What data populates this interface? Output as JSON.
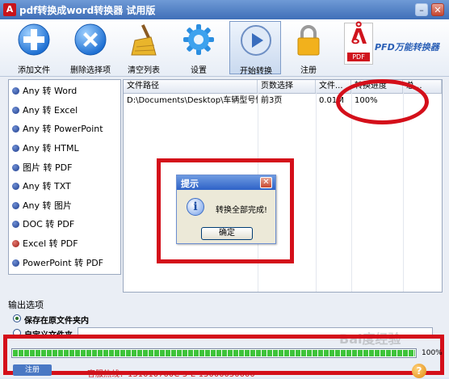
{
  "window": {
    "title": "pdf转换成word转换器 试用版",
    "min_label": "–",
    "close_label": "✕",
    "app_icon_glyph": "A"
  },
  "toolbar": {
    "add_file": "添加文件",
    "remove_selected": "删除选择项",
    "clear_list": "清空列表",
    "settings": "设置",
    "start_convert": "开始转换",
    "register": "注册",
    "brand_text": "PFD万能转换器",
    "brand_pdf_tag": "PDF",
    "brand_acrobat_glyph": "ᕔ"
  },
  "formats": [
    {
      "label": "Any 转 Word"
    },
    {
      "label": "Any 转 Excel"
    },
    {
      "label": "Any 转 PowerPoint"
    },
    {
      "label": "Any 转 HTML"
    },
    {
      "label": "图片 转 PDF"
    },
    {
      "label": "Any 转 TXT"
    },
    {
      "label": "Any 转 图片"
    },
    {
      "label": "DOC 转 PDF"
    },
    {
      "label": "Excel 转 PDF"
    },
    {
      "label": "PowerPoint 转 PDF"
    }
  ],
  "table": {
    "headers": [
      "文件路径",
      "页数选择",
      "文件...",
      "转换进度",
      "总..."
    ],
    "rows": [
      {
        "path": "D:\\Documents\\Desktop\\车辆型号情...",
        "pages": "前3页",
        "size": "0.01M",
        "progress": "100%",
        "total": ""
      }
    ]
  },
  "dialog": {
    "title": "提示",
    "message": "转换全部完成!",
    "ok": "确定",
    "close_glyph": "✕",
    "info_glyph": "i"
  },
  "output": {
    "section_label": "输出选项",
    "opt_original": "保存在原文件夹内",
    "opt_custom": "自定义文件夹",
    "path_value": ""
  },
  "progress": {
    "percent_text": "100%",
    "percent": 100,
    "hotline": "客服热线：131010700C-5-E-15000050000",
    "register_label": "注册",
    "help_glyph": "?"
  },
  "watermark": "Bai度经验",
  "colors": {
    "highlight_red": "#d40f1a",
    "progress_green": "#3ec33a",
    "title_blue": "#3f6fb8"
  }
}
